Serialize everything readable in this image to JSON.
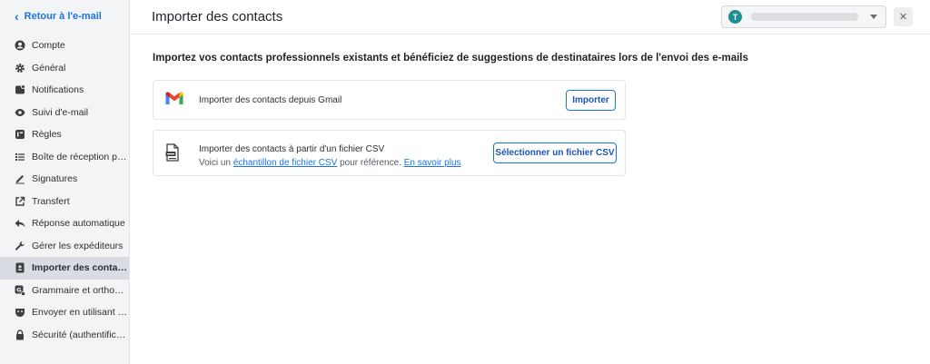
{
  "sidebar": {
    "back_label": "Retour à l'e-mail",
    "items": [
      {
        "label": "Compte",
        "icon": "account-circle-icon"
      },
      {
        "label": "Général",
        "icon": "gear-icon"
      },
      {
        "label": "Notifications",
        "icon": "notification-bell-icon"
      },
      {
        "label": "Suivi d'e-mail",
        "icon": "eye-icon"
      },
      {
        "label": "Règles",
        "icon": "rules-icon"
      },
      {
        "label": "Boîte de réception pri...",
        "icon": "priority-inbox-icon"
      },
      {
        "label": "Signatures",
        "icon": "signature-pen-icon"
      },
      {
        "label": "Transfert",
        "icon": "forward-share-icon"
      },
      {
        "label": "Réponse automatique",
        "icon": "reply-arrow-icon"
      },
      {
        "label": "Gérer les expéditeurs",
        "icon": "wrench-icon"
      },
      {
        "label": "Importer des contacts",
        "icon": "contact-card-icon",
        "active": true
      },
      {
        "label": "Grammaire et orthogr...",
        "icon": "grammar-check-icon"
      },
      {
        "label": "Envoyer en utilisant u...",
        "icon": "mask-icon"
      },
      {
        "label": "Sécurité (authentificati...",
        "icon": "lock-icon"
      }
    ]
  },
  "header": {
    "title": "Importer des contacts",
    "account_initial": "T"
  },
  "main": {
    "heading": "Importez vos contacts professionnels existants et bénéficiez de suggestions de destinataires lors de l'envoi des e-mails",
    "gmail": {
      "label": "Importer des contacts depuis Gmail",
      "button": "Importer"
    },
    "csv": {
      "label": "Importer des contacts à partir d'un fichier CSV",
      "sub_prefix": "Voici un ",
      "sample_link": "échantillon de fichier CSV",
      "sub_middle": " pour référence. ",
      "learn_more": "En savoir plus",
      "button": "Sélectionner un fichier CSV"
    }
  },
  "colors": {
    "accent": "#1a73e8",
    "avatar": "#1e8e8e",
    "active_item": "#d9dde3"
  }
}
